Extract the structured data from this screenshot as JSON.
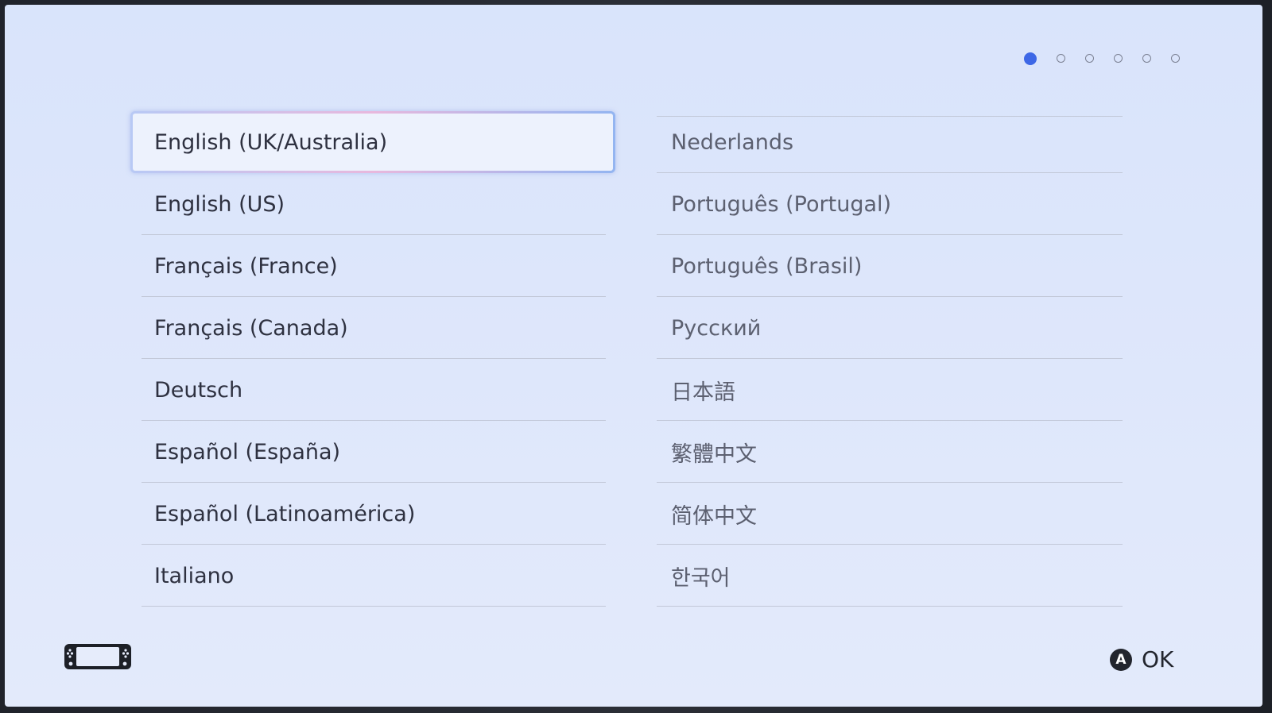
{
  "page_indicator": {
    "total": 6,
    "current": 1,
    "active_color": "#3d67e6"
  },
  "languages": {
    "left": [
      {
        "label": "English (UK/Australia)",
        "selected": true
      },
      {
        "label": "English (US)"
      },
      {
        "label": "Français (France)"
      },
      {
        "label": "Français (Canada)"
      },
      {
        "label": "Deutsch"
      },
      {
        "label": "Español (España)"
      },
      {
        "label": "Español (Latinoamérica)"
      },
      {
        "label": "Italiano"
      }
    ],
    "right": [
      {
        "label": "Nederlands"
      },
      {
        "label": "Português (Portugal)"
      },
      {
        "label": "Português (Brasil)"
      },
      {
        "label": "Русский"
      },
      {
        "label": "日本語"
      },
      {
        "label": "繁體中文"
      },
      {
        "label": "简体中文"
      },
      {
        "label": "한국어"
      }
    ]
  },
  "footer": {
    "console_icon": "handheld-console-icon",
    "confirm_button_glyph": "A",
    "confirm_label": "OK"
  }
}
